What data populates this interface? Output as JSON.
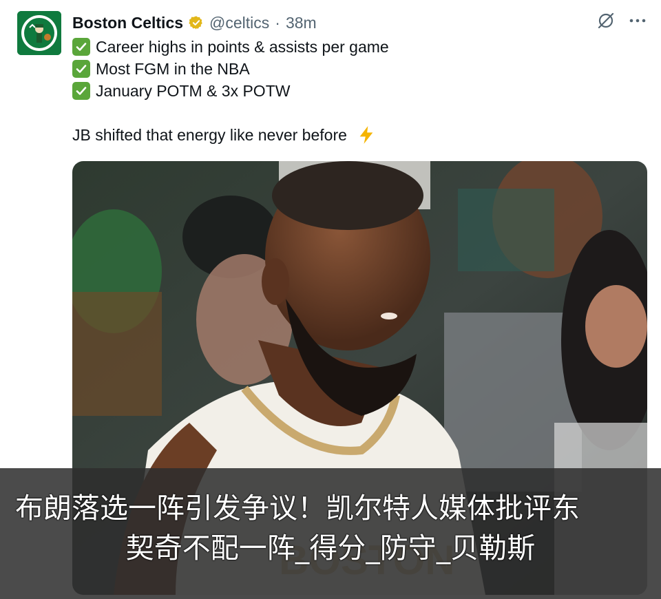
{
  "tweet": {
    "author_name": "Boston Celtics",
    "handle": "@celtics",
    "separator": "·",
    "time": "38m",
    "lines": [
      "Career highs in points & assists per game",
      "Most FGM in the NBA",
      "January POTM & 3x POTW"
    ],
    "closing_line": "JB shifted that energy like never before"
  },
  "icons": {
    "avatar": "celtics-logo",
    "verified": "verified-gold-badge-icon",
    "grok": "grok-icon",
    "more": "more-options-icon",
    "check": "check-mark-icon",
    "bolt": "lightning-bolt-icon"
  },
  "overlay": {
    "line1": "布朗落选一阵引发争议！凯尔特人媒体批评东",
    "line2": "契奇不配一阵_得分_防守_贝勒斯"
  },
  "colors": {
    "accent_green": "#0f7a3e",
    "check_green": "#5aa63a",
    "gold": "#e2b719",
    "muted": "#536471"
  }
}
